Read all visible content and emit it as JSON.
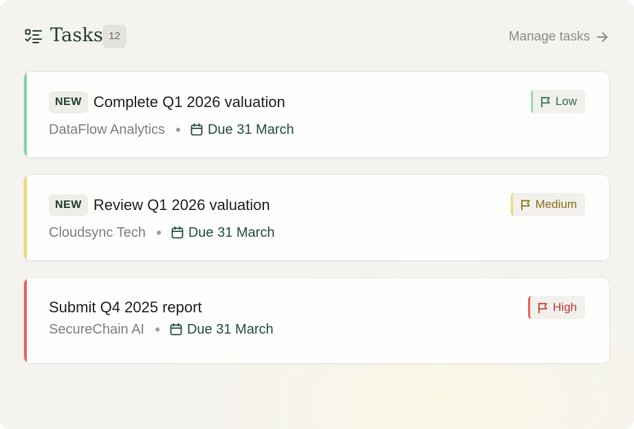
{
  "header": {
    "title": "Tasks",
    "count": "12",
    "manage_label": "Manage tasks",
    "title_icon": "checklist-icon",
    "manage_icon": "arrow-right-icon"
  },
  "colors": {
    "brand_green": "#1f3b2c",
    "low": "#7fd3ad",
    "medium": "#f0d96a",
    "high": "#e8605c"
  },
  "tasks": [
    {
      "badge": "NEW",
      "title": "Complete Q1 2026 valuation",
      "company": "DataFlow Analytics",
      "due": "Due 31 March",
      "priority": "Low"
    },
    {
      "badge": "NEW",
      "title": "Review Q1 2026 valuation",
      "company": "Cloudsync Tech",
      "due": "Due 31 March",
      "priority": "Medium"
    },
    {
      "badge": "",
      "title": "Submit Q4 2025 report",
      "company": "SecureChain AI",
      "due": "Due 31 March",
      "priority": "High"
    }
  ]
}
